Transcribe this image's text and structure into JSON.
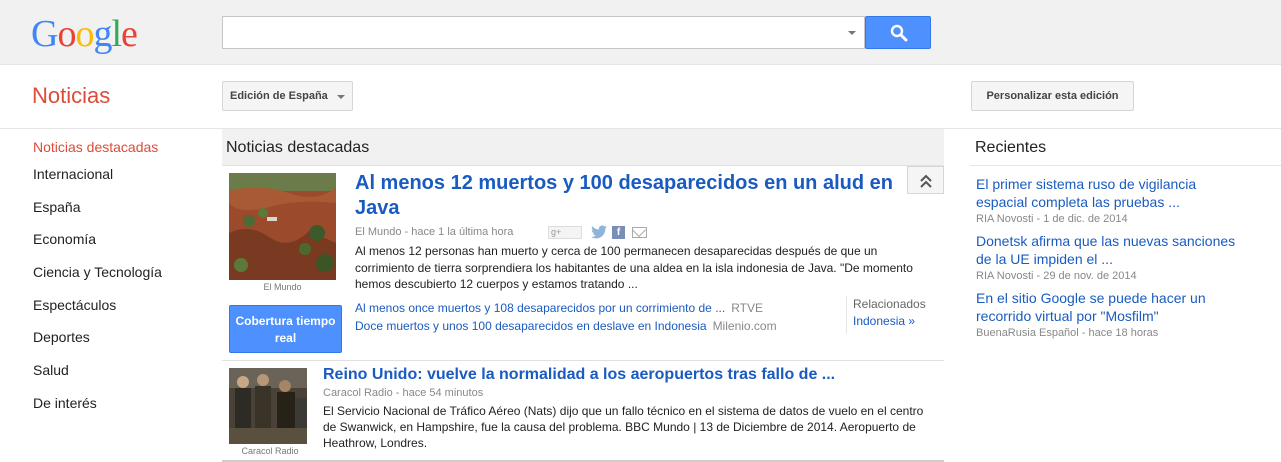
{
  "brand": {
    "logo_letters": [
      {
        "ch": "G",
        "color": "#4285f4"
      },
      {
        "ch": "o",
        "color": "#ea4335"
      },
      {
        "ch": "o",
        "color": "#fbbc05"
      },
      {
        "ch": "g",
        "color": "#4285f4"
      },
      {
        "ch": "l",
        "color": "#34a853"
      },
      {
        "ch": "e",
        "color": "#ea4335"
      }
    ]
  },
  "search": {
    "value": "",
    "button_icon": "search-icon"
  },
  "header": {
    "section_title": "Noticias",
    "edition_label": "Edición de España",
    "personalize_label": "Personalizar esta edición"
  },
  "nav": {
    "items": [
      {
        "label": "Noticias destacadas",
        "active": true
      },
      {
        "label": "Internacional"
      },
      {
        "label": "España"
      },
      {
        "label": "Economía"
      },
      {
        "label": "Ciencia y Tecnología"
      },
      {
        "label": "Espectáculos"
      },
      {
        "label": "Deportes"
      },
      {
        "label": "Salud"
      },
      {
        "label": "De interés"
      }
    ]
  },
  "main": {
    "title": "Noticias destacadas",
    "story1": {
      "headline": "Al menos 12 muertos y 100 desaparecidos en un alud en Java",
      "meta": "El Mundo - hace 1 la última hora",
      "snippet": "Al menos 12 personas han muerto y cerca de 100 permanecen desaparecidas después de que un corrimiento de tierra sorprendiera los habitantes de una aldea en la isla indonesia de Java. \"De momento hemos descubierto 12 cuerpos y estamos tratando ...",
      "image_caption": "El Mundo",
      "coverage_button": "Cobertura tiempo real",
      "share_gplus": "g+",
      "share_fb": "f",
      "related_links": [
        {
          "title": "Al menos once muertos y 108 desaparecidos por un corrimiento de ...",
          "source": "RTVE"
        },
        {
          "title": "Doce muertos y unos 100 desaparecidos en deslave en Indonesia",
          "source": "Milenio.com"
        }
      ],
      "related_label": "Relacionados",
      "related_topic": "Indonesia »"
    },
    "story2": {
      "headline": "Reino Unido: vuelve la normalidad a los aeropuertos tras fallo de ...",
      "meta": "Caracol Radio - hace 54 minutos",
      "snippet": "El Servicio Nacional de Tráfico Aéreo (Nats) dijo que un fallo técnico en el sistema de datos de vuelo en el centro de Swanwick, en Hampshire, fue la causa del problema. BBC Mundo | 13 de Diciembre de 2014. Aeropuerto de Heathrow, Londres.",
      "image_caption": "Caracol Radio"
    }
  },
  "recent": {
    "title": "Recientes",
    "items": [
      {
        "title": "El primer sistema ruso de vigilancia espacial completa las pruebas ...",
        "meta": "RIA Novosti - 1 de dic. de 2014"
      },
      {
        "title": "Donetsk afirma que las nuevas sanciones de la UE impiden el ...",
        "meta": "RIA Novosti - 29 de nov. de 2014"
      },
      {
        "title": "En el sitio Google se puede hacer un recorrido virtual por \"Mosfilm\"",
        "meta": "BuenaRusia Español - hace 18 horas"
      }
    ]
  },
  "colors": {
    "accent_red": "#dd4b39",
    "link_blue": "#1a5bc2",
    "button_blue": "#4d90fe"
  }
}
